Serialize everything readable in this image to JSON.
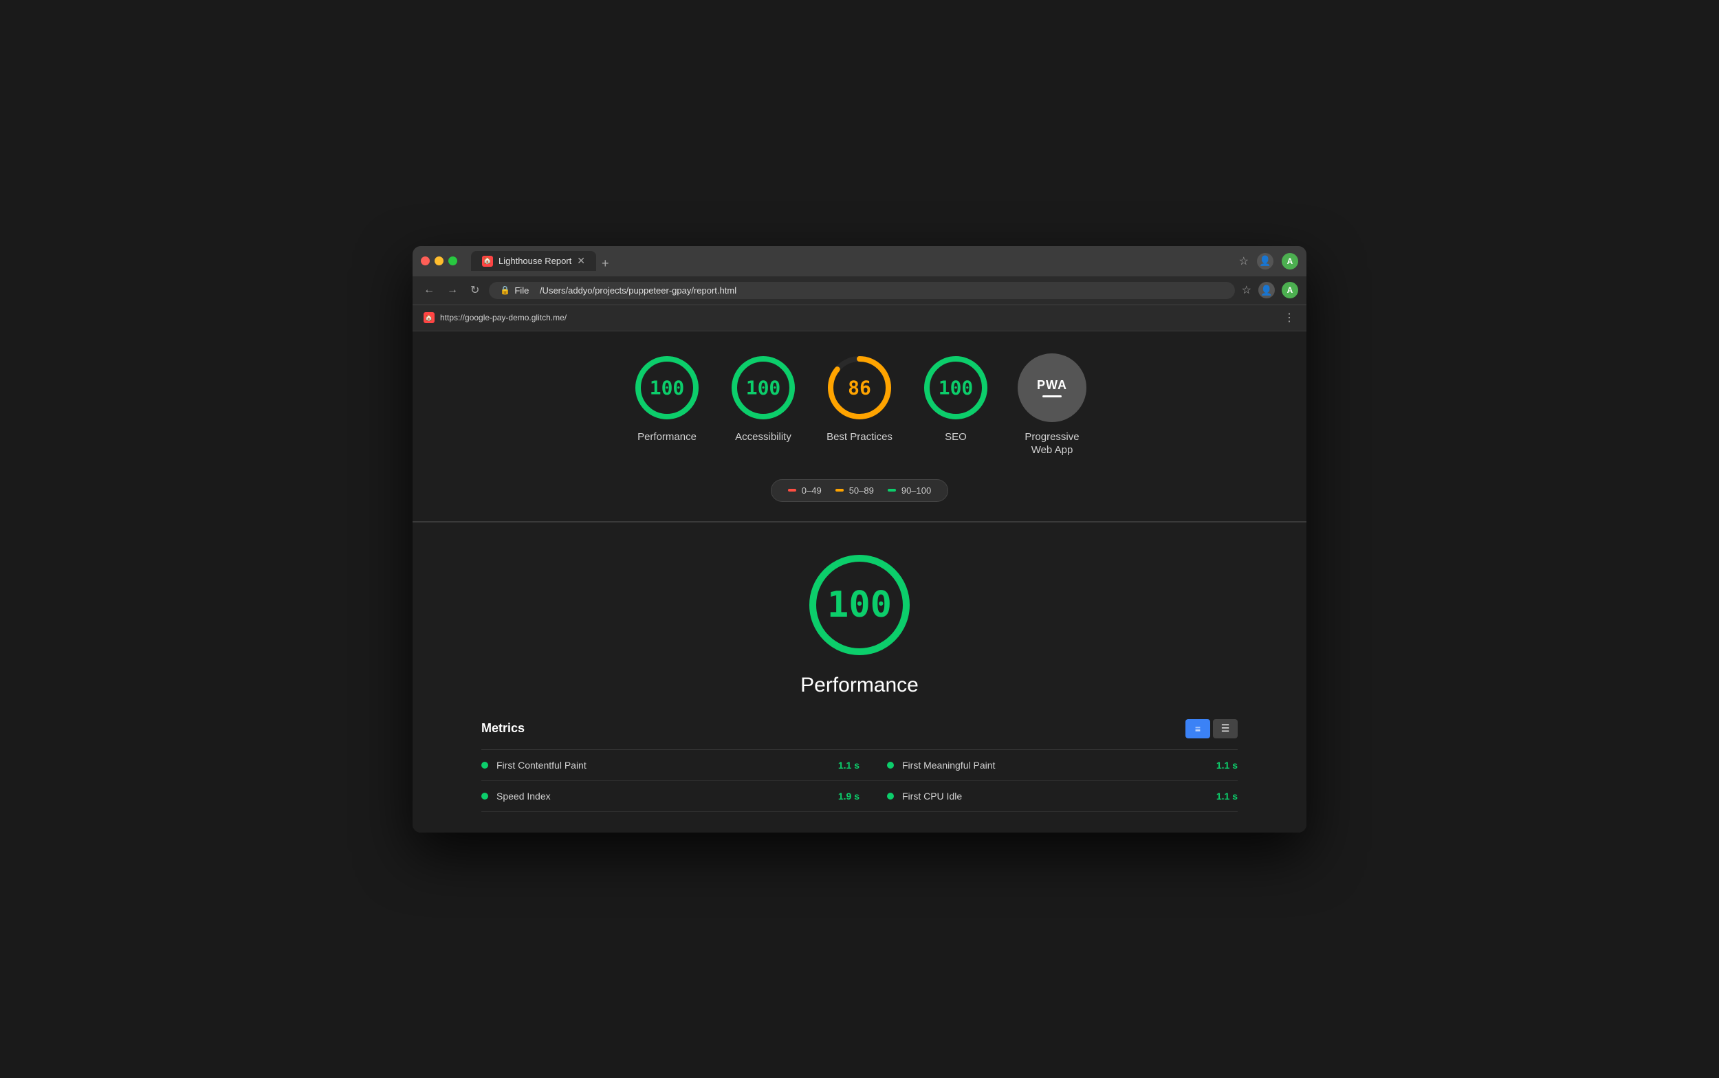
{
  "browser": {
    "tab_label": "Lighthouse Report",
    "favicon_text": "🏠",
    "address_protocol": "File",
    "address_path": "/Users/addyo/projects/puppeteer-gpay/report.html",
    "subtitle_url": "https://google-pay-demo.glitch.me/",
    "tab_close": "✕",
    "tab_new": "+"
  },
  "header": {
    "title": "Lighthouse Report"
  },
  "scores": [
    {
      "id": "performance",
      "value": "100",
      "label": "Performance",
      "color": "#0cce6b",
      "score": 100,
      "type": "circle"
    },
    {
      "id": "accessibility",
      "value": "100",
      "label": "Accessibility",
      "color": "#0cce6b",
      "score": 100,
      "type": "circle"
    },
    {
      "id": "best-practices",
      "value": "86",
      "label": "Best Practices",
      "color": "#ffa400",
      "score": 86,
      "type": "circle"
    },
    {
      "id": "seo",
      "value": "100",
      "label": "SEO",
      "color": "#0cce6b",
      "score": 100,
      "type": "circle"
    },
    {
      "id": "pwa",
      "value": "PWA",
      "label": "Progressive\nWeb App",
      "type": "pwa"
    }
  ],
  "legend": [
    {
      "id": "range-fail",
      "range": "0–49",
      "color": "red"
    },
    {
      "id": "range-average",
      "range": "50–89",
      "color": "orange"
    },
    {
      "id": "range-pass",
      "range": "90–100",
      "color": "green"
    }
  ],
  "detail": {
    "score": "100",
    "title": "Performance",
    "metrics_label": "Metrics"
  },
  "metrics": [
    {
      "name": "First Contentful Paint",
      "value": "1.1 s",
      "col": "left"
    },
    {
      "name": "First Meaningful Paint",
      "value": "1.1 s",
      "col": "right"
    },
    {
      "name": "Speed Index",
      "value": "1.9 s",
      "col": "left"
    },
    {
      "name": "First CPU Idle",
      "value": "1.1 s",
      "col": "right"
    }
  ],
  "colors": {
    "green": "#0cce6b",
    "orange": "#ffa400",
    "red": "#ff4e42",
    "background_dark": "#1e1e1e",
    "background_mid": "#2b2b2b",
    "text_primary": "#ffffff",
    "text_secondary": "#d0d0d0"
  }
}
